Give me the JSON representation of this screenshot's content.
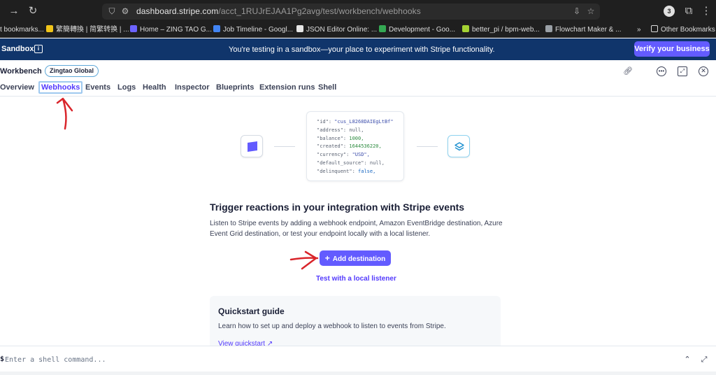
{
  "browser": {
    "url_prefix": "dashboard.stripe.com",
    "url_path": "/acct_1RUJrEJAA1Pg2avg/test/workbench/webhooks",
    "extension_badge": "3",
    "bookmarks": [
      {
        "label": "t bookmarks...",
        "color": "#1f1f1f"
      },
      {
        "label": "繁簡轉換 | 简繁转换 | ...",
        "color": "#f0c419"
      },
      {
        "label": "Home – ZING TAO G...",
        "color": "#6c63ff"
      },
      {
        "label": "Job Timeline - Googl...",
        "color": "#4285f4"
      },
      {
        "label": "JSON Editor Online: ...",
        "color": "#e6e6e6"
      },
      {
        "label": "Development - Goo...",
        "color": "#34a853"
      },
      {
        "label": "better_pi / bpm-web...",
        "color": "#a4d233"
      },
      {
        "label": "Flowchart Maker & ...",
        "color": "#9aa0a6"
      }
    ],
    "other_bookmarks": "Other Bookmarks"
  },
  "sandbox": {
    "label": "Sandbox",
    "message": "You're testing in a sandbox—your place to experiment with Stripe functionality.",
    "verify_button": "Verify your business"
  },
  "workbench": {
    "title": "Workbench",
    "account": "Zingtao Global",
    "tabs": [
      {
        "label": "Overview",
        "active": false
      },
      {
        "label": "Webhooks",
        "active": true
      },
      {
        "label": "Events",
        "active": false
      },
      {
        "label": "Logs",
        "active": false
      },
      {
        "label": "Health",
        "active": false
      },
      {
        "label": "Inspector",
        "active": false
      },
      {
        "label": "Blueprints",
        "active": false
      },
      {
        "label": "Extension runs",
        "active": false
      },
      {
        "label": "Shell",
        "active": false
      }
    ]
  },
  "illustration": {
    "json_lines": [
      {
        "key": "\"id\": ",
        "value": "\"cus_L8268DAIEgLtBf\"",
        "kind": "string"
      },
      {
        "key": "\"address\": ",
        "value": "null,",
        "kind": "null"
      },
      {
        "key": "\"balance\": ",
        "value": "1000,",
        "kind": "number"
      },
      {
        "key": "\"created\": ",
        "value": "1644536220,",
        "kind": "number"
      },
      {
        "key": "\"currency\": ",
        "value": "\"USD\",",
        "kind": "string"
      },
      {
        "key": "\"default_source\": ",
        "value": "null,",
        "kind": "null"
      },
      {
        "key": "\"delinquent\": ",
        "value": "false,",
        "kind": "bool"
      }
    ]
  },
  "main": {
    "title": "Trigger reactions in your integration with Stripe events",
    "description": "Listen to Stripe events by adding a webhook endpoint, Amazon EventBridge destination, Azure Event Grid destination, or test your endpoint locally with a local listener.",
    "add_button": "Add destination",
    "local_link": "Test with a local listener"
  },
  "quickstart": {
    "title": "Quickstart guide",
    "description": "Learn how to set up and deploy a webhook to listen to events from Stripe.",
    "link": "View quickstart"
  },
  "shell": {
    "prompt": "$",
    "placeholder": "Enter a shell command..."
  },
  "colors": {
    "accent": "#635bff",
    "banner": "#10356b",
    "annotation": "#d9252b"
  }
}
